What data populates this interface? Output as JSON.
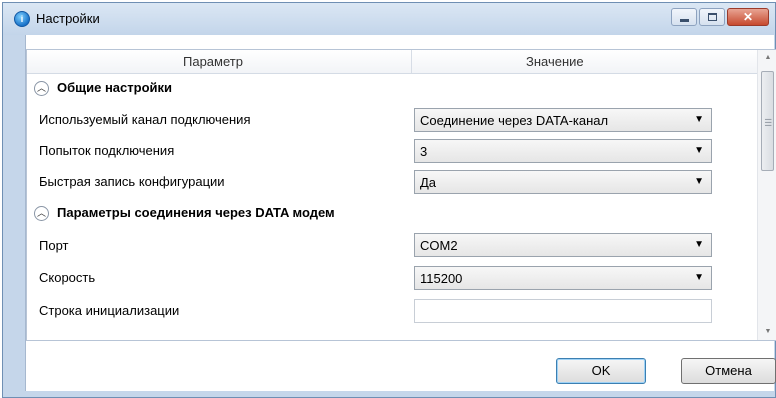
{
  "window": {
    "title": "Настройки",
    "icon": "app-info-icon"
  },
  "table": {
    "headers": {
      "param": "Параметр",
      "value": "Значение"
    },
    "sections": [
      {
        "title": "Общие настройки",
        "rows": [
          {
            "label": "Используемый канал подключения",
            "value": "Соединение через DATA-канал",
            "kind": "combo"
          },
          {
            "label": "Попыток подключения",
            "value": "3",
            "kind": "combo"
          },
          {
            "label": "Быстрая запись конфигурации",
            "value": "Да",
            "kind": "combo"
          }
        ]
      },
      {
        "title": "Параметры соединения через DATA модем",
        "rows": [
          {
            "label": "Порт",
            "value": "COM2",
            "kind": "combo"
          },
          {
            "label": "Скорость",
            "value": "115200",
            "kind": "combo"
          },
          {
            "label": "Строка инициализации",
            "value": "",
            "kind": "text"
          }
        ]
      }
    ]
  },
  "buttons": {
    "ok": "OK",
    "cancel": "Отмена"
  }
}
